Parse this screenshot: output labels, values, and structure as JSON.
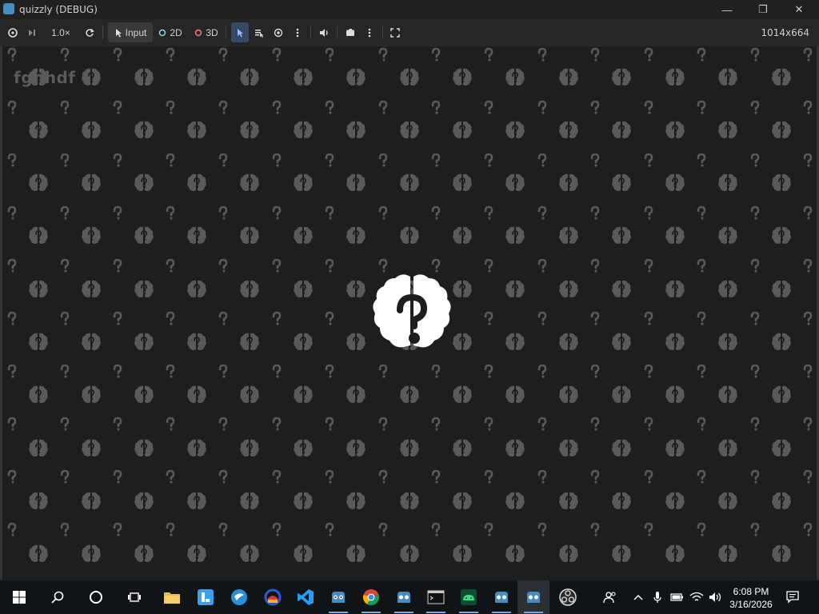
{
  "window": {
    "title": "quizzly (DEBUG)",
    "minimize_glyph": "—",
    "restore_glyph": "❐",
    "close_glyph": "✕"
  },
  "toolbar": {
    "speed_label": "1.0×",
    "input_label": "Input",
    "mode_2d_label": "2D",
    "mode_3d_label": "3D",
    "resolution": "1014x664",
    "icons": [
      "remote-debug-icon",
      "step-frame-icon",
      "reset-speed-icon",
      "input-icon",
      "2d-icon",
      "3d-icon",
      "select-icon",
      "list-select-icon",
      "visibility-icon",
      "more-icon",
      "audio-icon",
      "camera-icon",
      "more-icon",
      "fullscreen-icon"
    ]
  },
  "game": {
    "player_name": "fghhdf",
    "logo": "brain-question-logo",
    "pattern_icons": [
      "question-mark-icon",
      "brain-icon"
    ]
  },
  "taskbar": {
    "apps": [
      "start",
      "search",
      "cortana",
      "task-view",
      "file-explorer",
      "intellij",
      "vpn",
      "obs-style",
      "vscode",
      "godot",
      "chrome",
      "godot",
      "terminal",
      "android-studio",
      "godot",
      "godot-current",
      "obs"
    ],
    "tray_icons": [
      "people-icon",
      "chevron-up-icon",
      "mic-icon",
      "battery-icon",
      "wifi-icon",
      "volume-icon"
    ],
    "time": "6:08 PM",
    "date": "3/16/2026",
    "notifications_icon": "notification-icon"
  },
  "colors": {
    "background": "#1e1e1e",
    "pattern": "#555555",
    "logo": "#ffffff",
    "accent": "#478cbf",
    "selected": "#8fb8ff"
  }
}
